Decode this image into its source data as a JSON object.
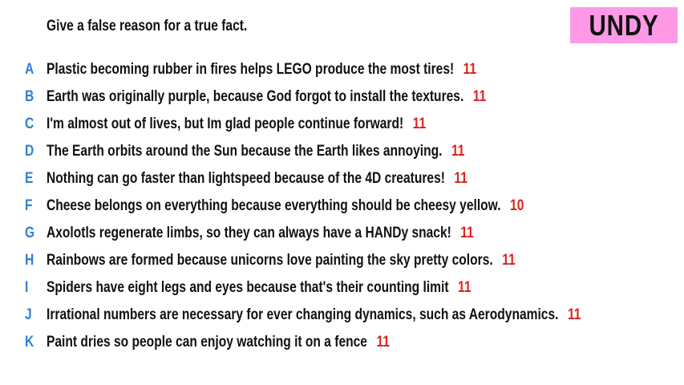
{
  "prompt": "Give a false reason for a true fact.",
  "badge": {
    "label": "UNDY",
    "color": "#ff99e6"
  },
  "colors": {
    "letter": "#2f7fd6",
    "score": "#e0201b",
    "text": "#111111"
  },
  "answers": [
    {
      "letter": "A",
      "text": "Plastic becoming rubber in fires helps LEGO produce the most tires!",
      "score": "11"
    },
    {
      "letter": "B",
      "text": "Earth was originally purple, because God forgot to install the textures.",
      "score": "11"
    },
    {
      "letter": "C",
      "text": "I'm almost out of lives, but Im glad people continue forward!",
      "score": "11"
    },
    {
      "letter": "D",
      "text": "The Earth orbits around the Sun because the Earth likes annoying.",
      "score": "11"
    },
    {
      "letter": "E",
      "text": "Nothing can go faster than lightspeed because of the 4D creatures!",
      "score": "11"
    },
    {
      "letter": "F",
      "text": "Cheese belongs on everything because everything should be cheesy yellow.",
      "score": "10"
    },
    {
      "letter": "G",
      "text": "Axolotls regenerate limbs, so they can always have a HANDy snack!",
      "score": "11"
    },
    {
      "letter": "H",
      "text": "Rainbows are formed because unicorns love painting the sky pretty colors.",
      "score": "11"
    },
    {
      "letter": "I",
      "text": "Spiders have eight legs and eyes because that's their counting limit",
      "score": "11"
    },
    {
      "letter": "J",
      "text": "Irrational numbers are necessary for ever changing dynamics, such as Aerodynamics.",
      "score": "11"
    },
    {
      "letter": "K",
      "text": "Paint dries so people can enjoy watching it on a fence",
      "score": "11"
    }
  ]
}
